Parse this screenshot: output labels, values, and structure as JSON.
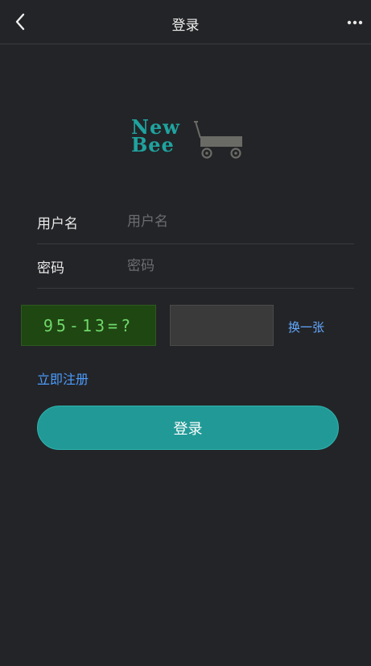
{
  "header": {
    "title": "登录"
  },
  "logo": {
    "line1": "New",
    "line2": "Bee",
    "brand_color": "#1fa39f"
  },
  "form": {
    "username": {
      "label": "用户名",
      "placeholder": "用户名",
      "value": ""
    },
    "password": {
      "label": "密码",
      "placeholder": "密码",
      "value": ""
    }
  },
  "captcha": {
    "text": "95-13=?",
    "input_value": "",
    "refresh_label": "换一张"
  },
  "register_label": "立即注册",
  "login_button": "登录",
  "colors": {
    "background": "#232427",
    "accent": "#219a97",
    "link": "#4b9cff",
    "captcha_bg": "#1f4712",
    "captcha_text": "#6fd86a"
  },
  "icons": {
    "back": "chevron-left-icon",
    "more": "more-horizontal-icon",
    "wagon": "wagon-icon"
  }
}
